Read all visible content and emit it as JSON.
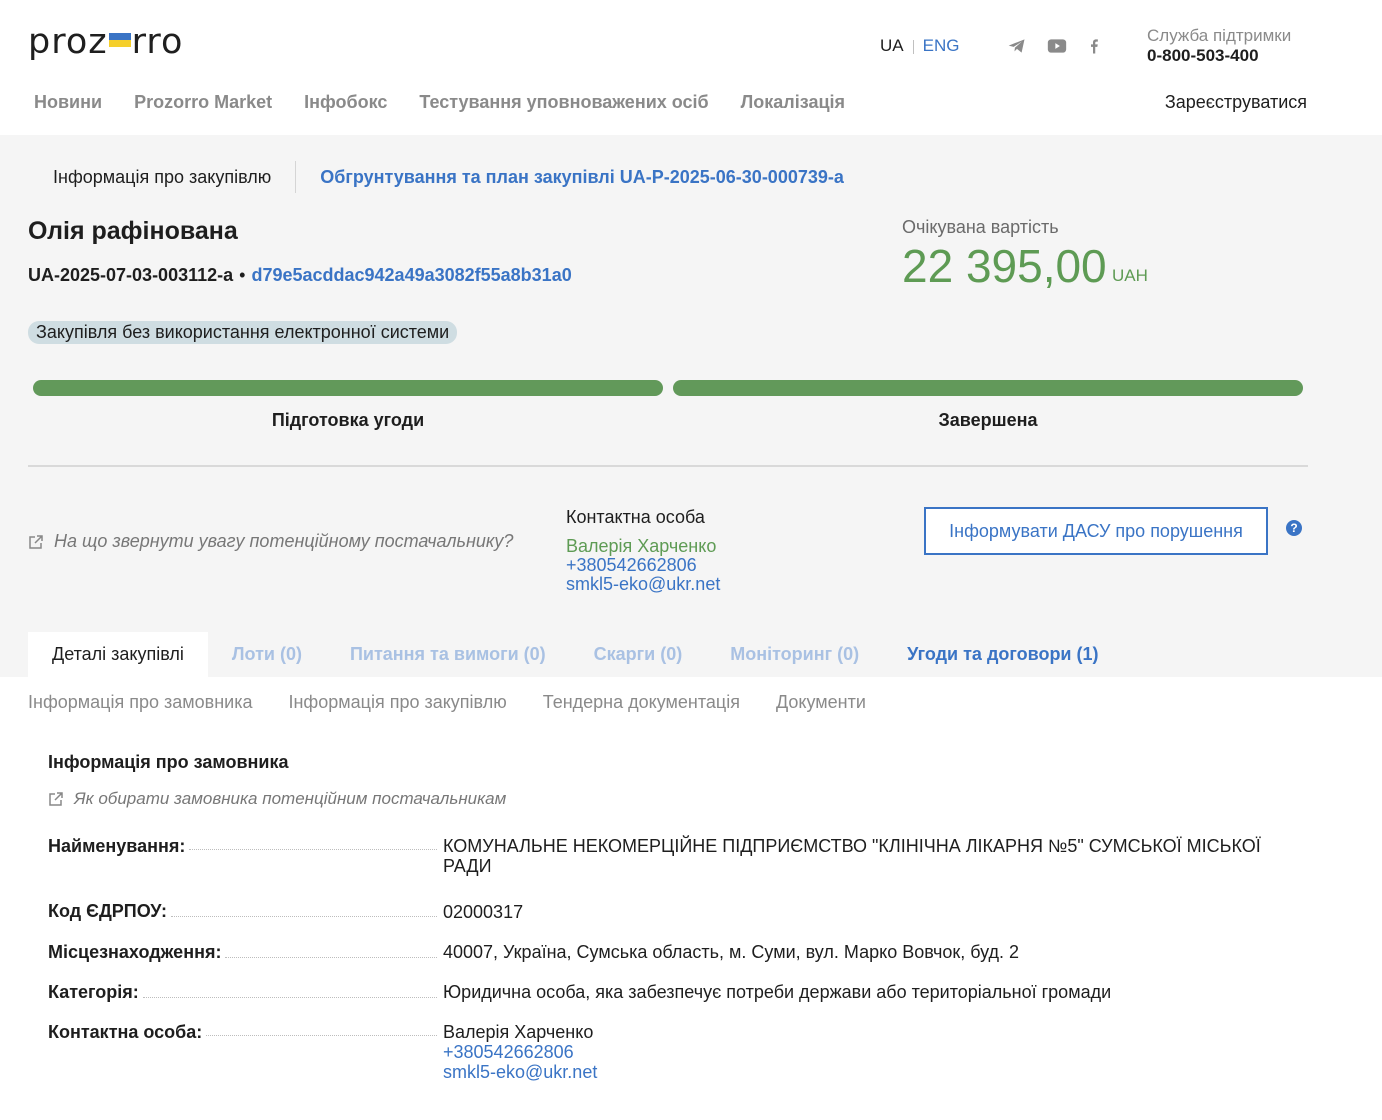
{
  "header": {
    "logo_left": "proz",
    "logo_right": "rro",
    "lang_ua": "UA",
    "lang_eng": "ENG",
    "support_label": "Служба підтримки",
    "support_phone": "0-800-503-400",
    "nav": [
      "Новини",
      "Prozorro Market",
      "Інфобокс",
      "Тестування уповноважених осіб",
      "Локалізація"
    ],
    "register": "Зареєструватися"
  },
  "subtabs": {
    "info": "Інформація про закупівлю",
    "plan": "Обгрунтування та план закупівлі UA-P-2025-06-30-000739-a"
  },
  "tender": {
    "title": "Олія рафінована",
    "id": "UA-2025-07-03-003112-a",
    "hash": "d79e5acddac942a49a3082f55a8b31a0",
    "badge": "Закупівля без використання електронної системи",
    "expected_label": "Очікувана вартість",
    "expected_value": "22 395,00",
    "currency": "UAH"
  },
  "stages": [
    {
      "label": "Підготовка угоди",
      "progress": 1.0
    },
    {
      "label": "Завершена",
      "progress": 1.0
    }
  ],
  "colors": {
    "accent": "#3a74c5",
    "success": "#5e9b54",
    "bar": "#62995a"
  },
  "hint": "На що звернути увагу потенційному постачальнику?",
  "contact": {
    "title": "Контактна особа",
    "name": "Валерія Харченко",
    "phone": "+380542662806",
    "email": "smkl5-eko@ukr.net"
  },
  "dasu_button": "Інформувати ДАСУ про порушення",
  "help_icon": "?",
  "tabs": [
    "Деталі закупівлі",
    "Лоти (0)",
    "Питання та вимоги (0)",
    "Скарги (0)",
    "Моніторинг (0)",
    "Угоди та договори (1)"
  ],
  "subnav": [
    "Інформація про замовника",
    "Інформація про закупівлю",
    "Тендерна документація",
    "Документи"
  ],
  "customer": {
    "title": "Інформація про замовника",
    "hint": "Як обирати замовника потенційним постачальникам",
    "name_label": "Найменування:",
    "name_value": "КОМУНАЛЬНЕ НЕКОМЕРЦІЙНЕ ПІДПРИЄМСТВО \"КЛІНІЧНА ЛІКАРНЯ №5\" СУМСЬКОЇ МІСЬКОЇ РАДИ",
    "code_label": "Код ЄДРПОУ:",
    "code_value": "02000317",
    "location_label": "Місцезнаходження:",
    "location_value": "40007, Україна, Сумська область, м. Суми, вул. Марко Вовчок, буд. 2",
    "category_label": "Категорія:",
    "category_value": "Юридична особа, яка забезпечує потреби держави або територіальної громади",
    "contact_label": "Контактна особа:",
    "contact_name": "Валерія Харченко",
    "contact_phone": "+380542662806",
    "contact_email": "smkl5-eko@ukr.net"
  }
}
